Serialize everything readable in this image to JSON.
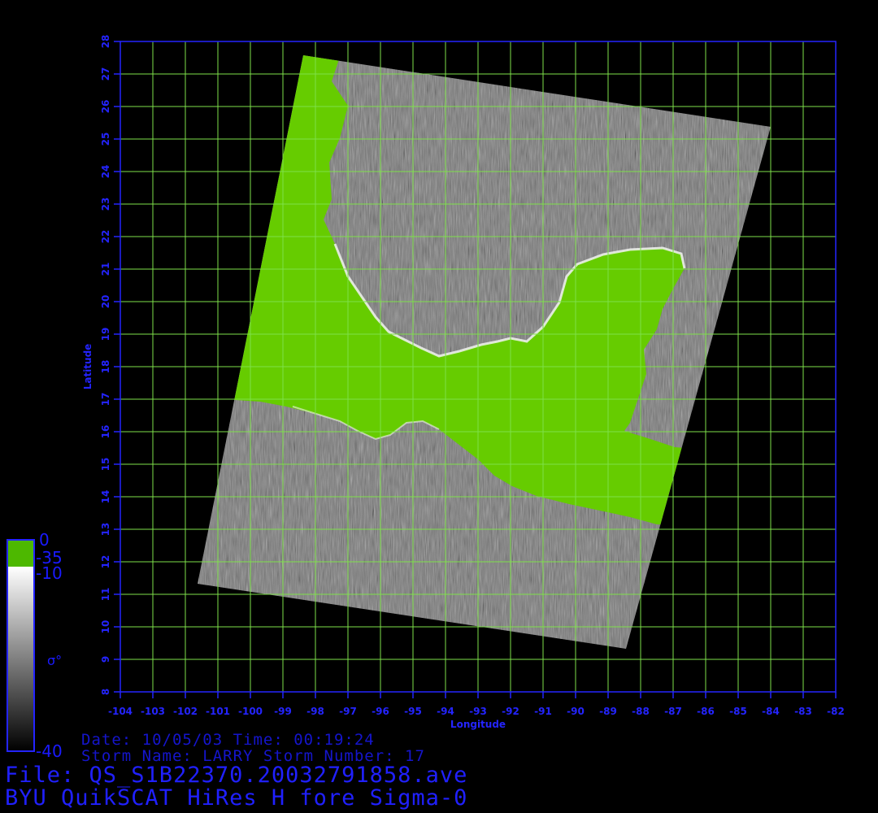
{
  "map": {
    "xlabel": "Longitude",
    "ylabel": "Latitude",
    "lon_range": [
      -104,
      -82
    ],
    "lat_range": [
      8,
      28
    ],
    "lon_ticks": [
      "-104",
      "-103",
      "-102",
      "-101",
      "-100",
      "-99",
      "-98",
      "-97",
      "-96",
      "-95",
      "-94",
      "-93",
      "-92",
      "-91",
      "-90",
      "-89",
      "-88",
      "-87",
      "-86",
      "-85",
      "-84",
      "-83",
      "-82"
    ],
    "lat_ticks": [
      "8",
      "9",
      "10",
      "11",
      "12",
      "13",
      "14",
      "15",
      "16",
      "17",
      "18",
      "19",
      "20",
      "21",
      "22",
      "23",
      "24",
      "25",
      "26",
      "27",
      "28"
    ],
    "grid": true,
    "colors": {
      "frame": "#2424ff",
      "grid": "#7ee04a",
      "land": "#66cc00",
      "background": "#000000"
    }
  },
  "colorbar": {
    "green_top": "0",
    "green_bottom": "-35",
    "gray_top": "-10",
    "gray_bottom": "-40",
    "symbol": "σ°"
  },
  "info": {
    "date_line": "Date: 10/05/03  Time: 00:19:24",
    "storm_line": "Storm Name: LARRY  Storm Number: 17",
    "file_line": "File: QS_S1B22370.20032791858.ave",
    "title_line": "BYU QuikSCAT HiRes H fore Sigma-0"
  }
}
